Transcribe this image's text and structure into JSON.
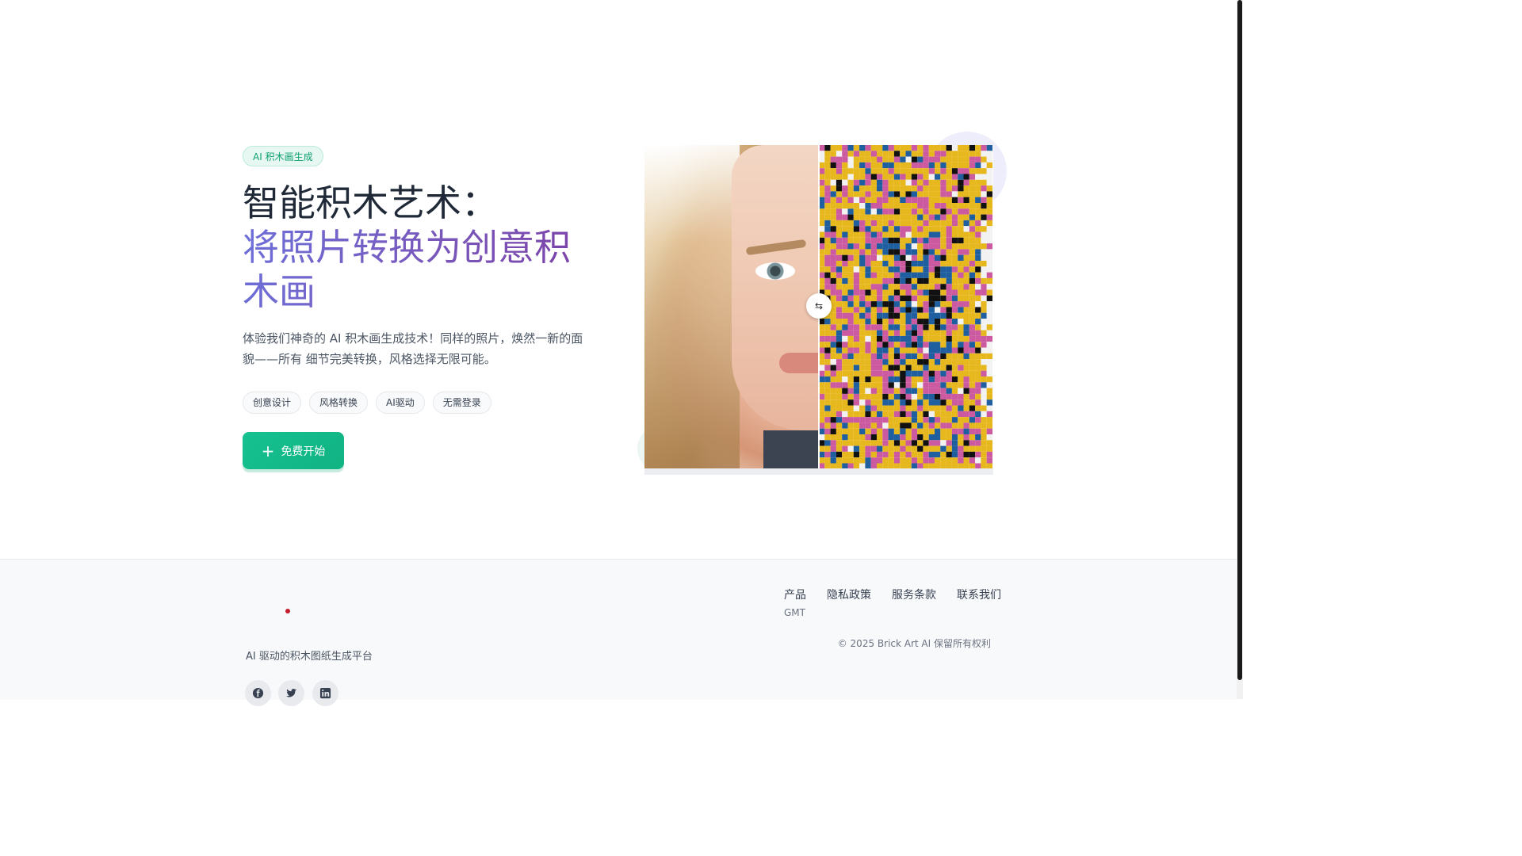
{
  "hero": {
    "badge": "AI 积木画生成",
    "title_line1": "智能积木艺术：",
    "title_line2": "将照片转换为创意积木画",
    "description": "体验我们神奇的 AI 积木画生成技术！同样的照片，焕然一新的面貌——所有 细节完美转换，风格选择无限可能。",
    "tags": [
      "创意设计",
      "风格转换",
      "AI驱动",
      "无需登录"
    ],
    "cta_label": "免费开始"
  },
  "compare": {
    "handle_icon": "swap-icon",
    "brick_palette": [
      "#e6b81e",
      "#cc5aa0",
      "#1f5fa0",
      "#111111",
      "#f2f2f2"
    ]
  },
  "footer": {
    "tagline": "AI 驱动的积木图纸生成平台",
    "nav": [
      "产品",
      "隐私政策",
      "服务条款",
      "联系我们"
    ],
    "gmt": "GMT",
    "copyright": "© 2025 Brick Art AI 保留所有权利",
    "social": [
      "facebook-icon",
      "twitter-icon",
      "linkedin-icon"
    ]
  }
}
